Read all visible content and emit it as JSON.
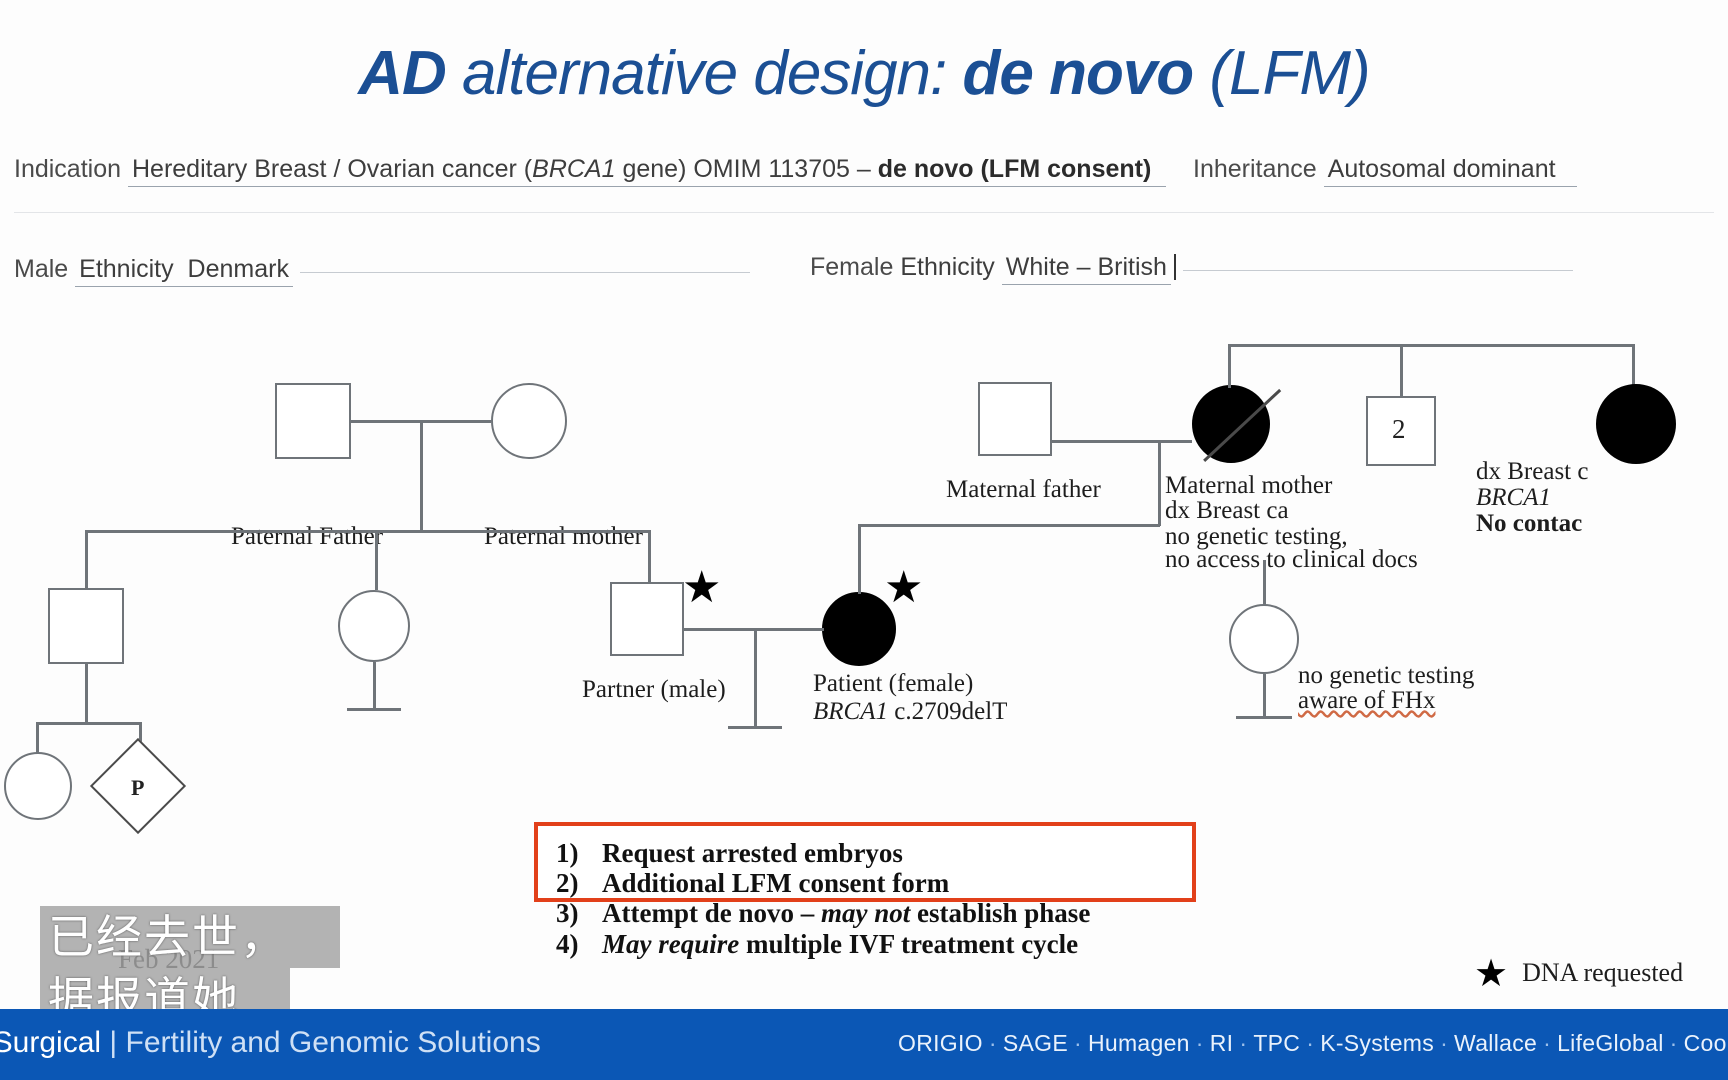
{
  "slide": {
    "title": {
      "part1": "AD",
      "part2": " alternative design",
      "part3": ": ",
      "part4": "de novo",
      "part5": " (LFM)"
    },
    "header": {
      "indication_label": "Indication",
      "indication_value_a": "Hereditary Breast / Ovarian cancer (",
      "indication_gene": "BRCA1",
      "indication_value_b": " gene) OMIM 113705 – ",
      "indication_bold": "de novo (LFM consent)",
      "inheritance_label": "Inheritance",
      "inheritance_value": "Autosomal dominant"
    },
    "ethnicity": {
      "male_label": "Male",
      "male_field": "Ethnicity",
      "male_value": "Denmark",
      "female_label": "Female",
      "female_field": "Ethnicity",
      "female_value": "White – British"
    }
  },
  "pedigree": {
    "paternal_father": "Paternal Father",
    "paternal_mother": "Paternal mother",
    "partner": "Partner (male)",
    "patient_line1": "Patient (female)",
    "patient_gene": "BRCA1",
    "patient_variant": " c.2709delT",
    "maternal_father": "Maternal father",
    "maternal_mother_l1": "Maternal mother",
    "maternal_mother_l2": "dx Breast ca",
    "maternal_mother_l3": "no genetic testing,",
    "maternal_mother_l4": "no access to clinical docs",
    "sibship_count": "2",
    "aunt_l1": "dx Breast c",
    "aunt_gene": "BRCA1",
    "aunt_l3": "No contac",
    "cousin_l1": "no genetic testing",
    "cousin_l2": "aware of FHx",
    "proband_marker": "P",
    "star_glyph": "★"
  },
  "action_box": {
    "items": [
      {
        "num": "1)",
        "pre": "Request arrested embryos",
        "ital": "",
        "post": ""
      },
      {
        "num": "2)",
        "pre": "Additional LFM consent form",
        "ital": "",
        "post": ""
      },
      {
        "num": "3)",
        "pre": "Attempt de novo – ",
        "ital": "may not",
        "post": " establish phase"
      },
      {
        "num": "4)",
        "pre": "",
        "ital": "May require",
        "post": " multiple IVF treatment cycle"
      }
    ],
    "border_color": "#e2401a"
  },
  "legend": {
    "star_glyph": "★",
    "label": "DNA requested"
  },
  "date_text": "Feb 2021",
  "subtitle": {
    "line1": "已经去世，",
    "line2": "据报道她"
  },
  "footer": {
    "brand_left_a": "erSurgical",
    "brand_left_b": " | Fertility and Genomic Solutions",
    "brands": [
      "ORIGIO",
      "SAGE",
      "Humagen",
      "RI",
      "TPC",
      "K-Systems",
      "Wallace",
      "LifeGlobal",
      "CooperGenomics"
    ],
    "separator": "·",
    "bar_color": "#0b57b5"
  }
}
